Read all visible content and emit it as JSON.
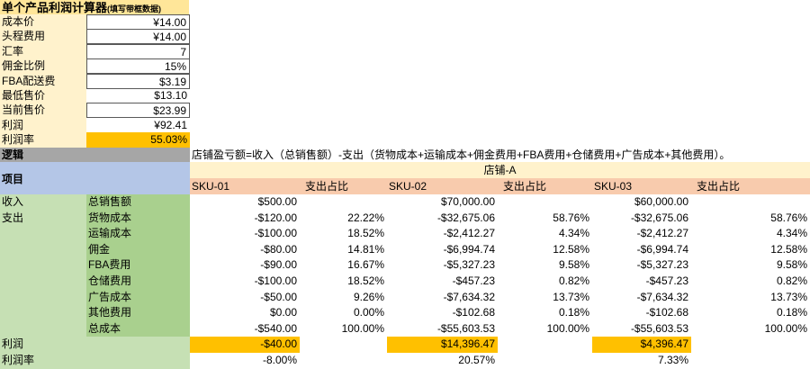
{
  "calc": {
    "title": "单个产品利润计算器",
    "title_note": "(填写带框数据)",
    "rows": [
      {
        "label": "成本价",
        "value": "¥14.00",
        "boxed": true,
        "gold": false
      },
      {
        "label": "头程费用",
        "value": "¥14.00",
        "boxed": true,
        "gold": false
      },
      {
        "label": "汇率",
        "value": "7",
        "boxed": true,
        "gold": false
      },
      {
        "label": "佣金比例",
        "value": "15%",
        "boxed": true,
        "gold": false
      },
      {
        "label": "FBA配送费",
        "value": "$3.19",
        "boxed": true,
        "gold": false
      },
      {
        "label": "最低售价",
        "value": "$13.10",
        "boxed": false,
        "gold": false
      },
      {
        "label": "当前售价",
        "value": "$23.99",
        "boxed": true,
        "gold": false
      },
      {
        "label": "利润",
        "value": "¥92.41",
        "boxed": false,
        "gold": false
      },
      {
        "label": "利润率",
        "value": "55.03%",
        "boxed": false,
        "gold": true
      }
    ]
  },
  "logic": {
    "label": "逻辑",
    "formula": "店铺盈亏额=收入（总销售额）-支出（货物成本+运输成本+佣金费用+FBA费用+仓储费用+广告成本+其他费用）。"
  },
  "table": {
    "item_label": "项目",
    "store_name": "店铺-A",
    "sku_headers": [
      "SKU-01",
      "SKU-02",
      "SKU-03"
    ],
    "share_header": "支出占比",
    "categories": [
      {
        "cat": "收入",
        "item": "总销售额",
        "vals": [
          "$500.00",
          "",
          "$70,000.00",
          "",
          "$60,000.00",
          ""
        ]
      },
      {
        "cat": "支出",
        "item": "货物成本",
        "vals": [
          "-$120.00",
          "22.22%",
          "-$32,675.06",
          "58.76%",
          "-$32,675.06",
          "58.76%"
        ]
      },
      {
        "cat": "",
        "item": "运输成本",
        "vals": [
          "-$100.00",
          "18.52%",
          "-$2,412.27",
          "4.34%",
          "-$2,412.27",
          "4.34%"
        ]
      },
      {
        "cat": "",
        "item": "佣金",
        "vals": [
          "-$80.00",
          "14.81%",
          "-$6,994.74",
          "12.58%",
          "-$6,994.74",
          "12.58%"
        ]
      },
      {
        "cat": "",
        "item": "FBA费用",
        "vals": [
          "-$90.00",
          "16.67%",
          "-$5,327.23",
          "9.58%",
          "-$5,327.23",
          "9.58%"
        ]
      },
      {
        "cat": "",
        "item": "仓储费用",
        "vals": [
          "-$100.00",
          "18.52%",
          "-$457.23",
          "0.82%",
          "-$457.23",
          "0.82%"
        ]
      },
      {
        "cat": "",
        "item": "广告成本",
        "vals": [
          "-$50.00",
          "9.26%",
          "-$7,634.32",
          "13.73%",
          "-$7,634.32",
          "13.73%"
        ]
      },
      {
        "cat": "",
        "item": "其他费用",
        "vals": [
          "$0.00",
          "0.00%",
          "-$102.68",
          "0.18%",
          "-$102.68",
          "0.18%"
        ]
      },
      {
        "cat": "",
        "item": "总成本",
        "vals": [
          "-$540.00",
          "100.00%",
          "-$55,603.53",
          "100.00%",
          "-$55,603.53",
          "100.00%"
        ]
      }
    ],
    "profit_label": "利润",
    "profit_vals": [
      "-$40.00",
      "$14,396.47",
      "$4,396.47"
    ],
    "margin_label": "利润率",
    "margin_vals": [
      "-8.00%",
      "20.57%",
      "7.33%"
    ]
  }
}
